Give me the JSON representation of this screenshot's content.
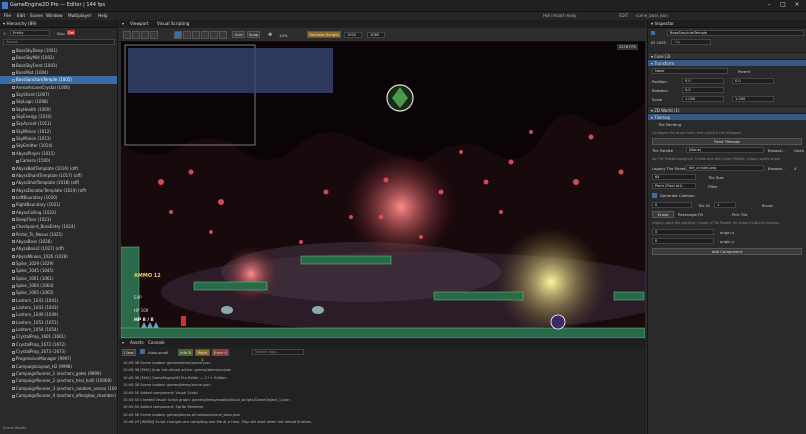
{
  "titlebar": {
    "title": "GameEngine2D Pro — Editor | 144 fps"
  },
  "menubar": {
    "items": [
      "File",
      "Edit",
      "Scene",
      "Window",
      "Multiplayer",
      "Help"
    ]
  },
  "status": {
    "hot_reload": "Hot reload ready",
    "edit": "EDIT",
    "scene": "scene_boss.json"
  },
  "hierarchy": {
    "title": "Hierarchy (89)",
    "filter_label": "Entity",
    "dup_label": "Dup",
    "del_label": "Del",
    "search_placeholder": "Search",
    "rows": [
      {
        "label": "BossSkyDeep (1001)",
        "sel": false
      },
      {
        "label": "BossSkyMid (1002)",
        "sel": false
      },
      {
        "label": "BossSkyFront (1003)",
        "sel": false
      },
      {
        "label": "BossMist (1004)",
        "sel": false
      },
      {
        "label": "BossSanctumTemple (1005)",
        "sel": true
      },
      {
        "label": "ArenaArcaneCrystal (1006)",
        "sel": false
      },
      {
        "label": "SkyShard (1007)",
        "sel": false
      },
      {
        "label": "SkyLogic (1008)",
        "sel": false
      },
      {
        "label": "SkyHealth (1009)",
        "sel": false
      },
      {
        "label": "SkyEnergy (1010)",
        "sel": false
      },
      {
        "label": "SkyAccent (1011)",
        "sel": false
      },
      {
        "label": "SkyMinion (1012)",
        "sel": false
      },
      {
        "label": "SkyMinion (1013)",
        "sel": false
      },
      {
        "label": "SkyEmitter (1014)",
        "sel": false
      },
      {
        "label": "AbyssPlayer (1015)",
        "sel": false
      },
      {
        "label": "Camera (1500)",
        "sel": false,
        "ind": true
      },
      {
        "label": "AbyssBoltTemplate (1016) (off)",
        "sel": false
      },
      {
        "label": "AbyssShardTemplate (1017) (off)",
        "sel": false
      },
      {
        "label": "AbyssShotTemplate (1018) (off)",
        "sel": false
      },
      {
        "label": "AbyssDonatorTemplate (1019) (off)",
        "sel": false
      },
      {
        "label": "LeftBoundary (1020)",
        "sel": false
      },
      {
        "label": "RightBoundary (1021)",
        "sel": false
      },
      {
        "label": "AbyssCeiling (1022)",
        "sel": false
      },
      {
        "label": "DeepFloor (1023)",
        "sel": false
      },
      {
        "label": "Checkpoint_BossEntry (1024)",
        "sel": false
      },
      {
        "label": "Portal_To_Nexus (1025)",
        "sel": false
      },
      {
        "label": "AbyssBoss (1026)",
        "sel": false
      },
      {
        "label": "AbyssBoss2 (1027) (off)",
        "sel": false
      },
      {
        "label": "AbyssMinion_1026 (1028)",
        "sel": false
      },
      {
        "label": "Spike_1029 (1029)",
        "sel": false
      },
      {
        "label": "Spike_1045 (1045)",
        "sel": false
      },
      {
        "label": "Spike_1061 (1061)",
        "sel": false
      },
      {
        "label": "Spike_1064 (1064)",
        "sel": false
      },
      {
        "label": "Spike_1065 (1065)",
        "sel": false
      },
      {
        "label": "Lantern_1041 (1041)",
        "sel": false
      },
      {
        "label": "Lantern_1043 (1043)",
        "sel": false
      },
      {
        "label": "Lantern_1049 (1049)",
        "sel": false
      },
      {
        "label": "Lantern_1051 (1051)",
        "sel": false
      },
      {
        "label": "Lantern_1054 (1054)",
        "sel": false
      },
      {
        "label": "CrystalProp_1601 (1601)",
        "sel": false
      },
      {
        "label": "CrystalProp_1672 (1672)",
        "sel": false
      },
      {
        "label": "CrystalProp_1673 (1673)",
        "sel": false
      },
      {
        "label": "ProgressionManager (9997)",
        "sel": false
      },
      {
        "label": "CampaignLayout_H2 (9998)",
        "sel": false
      },
      {
        "label": "CampaignRunner_1 (anchors_gate) (9999)",
        "sel": false
      },
      {
        "label": "CampaignRunner_2 (anchors_trial_hall) (10000)",
        "sel": false
      },
      {
        "label": "CampaignRunner_3 (anchors_random_arena) (10001)",
        "sel": false
      },
      {
        "label": "CampaignRunner_4 (anchors_afterglow_chamber) (10002)",
        "sel": false
      }
    ],
    "footer": "Scene Ready"
  },
  "tabs": [
    {
      "label": "Viewport"
    },
    {
      "label": "Visual Scripting"
    }
  ],
  "toolbar": {
    "grid_label": "Grid",
    "snap_label": "Snap",
    "zoom": "10%",
    "play_btn": "Remove Scripts",
    "res_w": "1920",
    "res_h": "1080"
  },
  "viewport": {
    "fps_badge": "2276 FPS",
    "hud": {
      "ammo": "AMMO 12",
      "exp": "EXP",
      "hp_small": "HP 100",
      "hp": "HP 8 / 8"
    }
  },
  "console": {
    "tabs": [
      "Assets",
      "Console"
    ],
    "clear": "Clear",
    "autoscroll": "Auto-scroll",
    "info": "Info 8",
    "warn": "Warn 1",
    "err": "Error 0",
    "search_placeholder": "Search logs...",
    "lines": [
      "10:45:38  Scene loaded: games/demo/scene.json",
      "10:45:38  [ENG] Auto hot-reload active: games/demo/scripts",
      "10:45:38  [ENG] GameEngine2D Pro Editor — C++ Edition",
      "10:45:38  Scene loaded: games/demo/scene.json",
      "10:45:50  Added component: Visual Script",
      "10:45:50  Created Visual Script graph: games/demo/assets/visual_scripts/GameObject_1.json",
      "10:45:50  Added component: Sprite Renderer",
      "10:45:58  Scene loaded: games/abyss-of-hollows/scene_boss.json",
      "10:46:29  [WARN] Script changes are compiling one file at a time. Play will start when hot reload finishes."
    ]
  },
  "inspector": {
    "title": "Inspector",
    "name_value": "BossSanctumTemple",
    "id_label": "ID 1005",
    "tag_placeholder": "Tag",
    "core_label": "Core (3)",
    "transform_label": "Transform",
    "parent_none": "None",
    "parent_btn": "Parent",
    "position_label": "Position",
    "rotation_label": "Rotation",
    "scale_label": "Scale",
    "pos_x": "0.0",
    "pos_y": "0.0",
    "rot": "0.0",
    "scale_x": "1.000",
    "scale_y": "1.000",
    "world_label": "2D World (1)",
    "tilemap_label": "Tilemap",
    "tile_painting": "Tile Painting",
    "hint1": "Configure the brush here, then paint in the Viewport.",
    "paint_btn": "Paint Tilemap",
    "palette_label": "Tile Palette",
    "palette_value": "(None)",
    "browse": "Browse...",
    "open": "Open",
    "palette_hint": "No Tile Palette assigned. Create one with Open Palette. Legacy sprite sheet",
    "legacy_label": "Legacy Tile Sheet",
    "legacy_value": "tile_crystal.png",
    "browse2": "Browse...",
    "x_btn": "X",
    "tile_size": "64",
    "tile_size_label": "Tile Size",
    "paint_mode": "Paint (Pixel Art)",
    "filter": "Filter",
    "gen_coll": "Generate Collision",
    "tile_id_label": "Tile ID",
    "tile_id": "1",
    "brush": "Brush",
    "b0": "0",
    "erase": "Erase",
    "rect_fill": "Rectangle Fill",
    "flood": "Pick Tile",
    "hint2": "Legacy paint tile painting. Create a Tile Palette for visual multi-tile brushes.",
    "origin_x_val": "0",
    "origin_x": "origin x",
    "origin_y_val": "0",
    "origin_y": "origin y",
    "add_component": "Add Component"
  }
}
